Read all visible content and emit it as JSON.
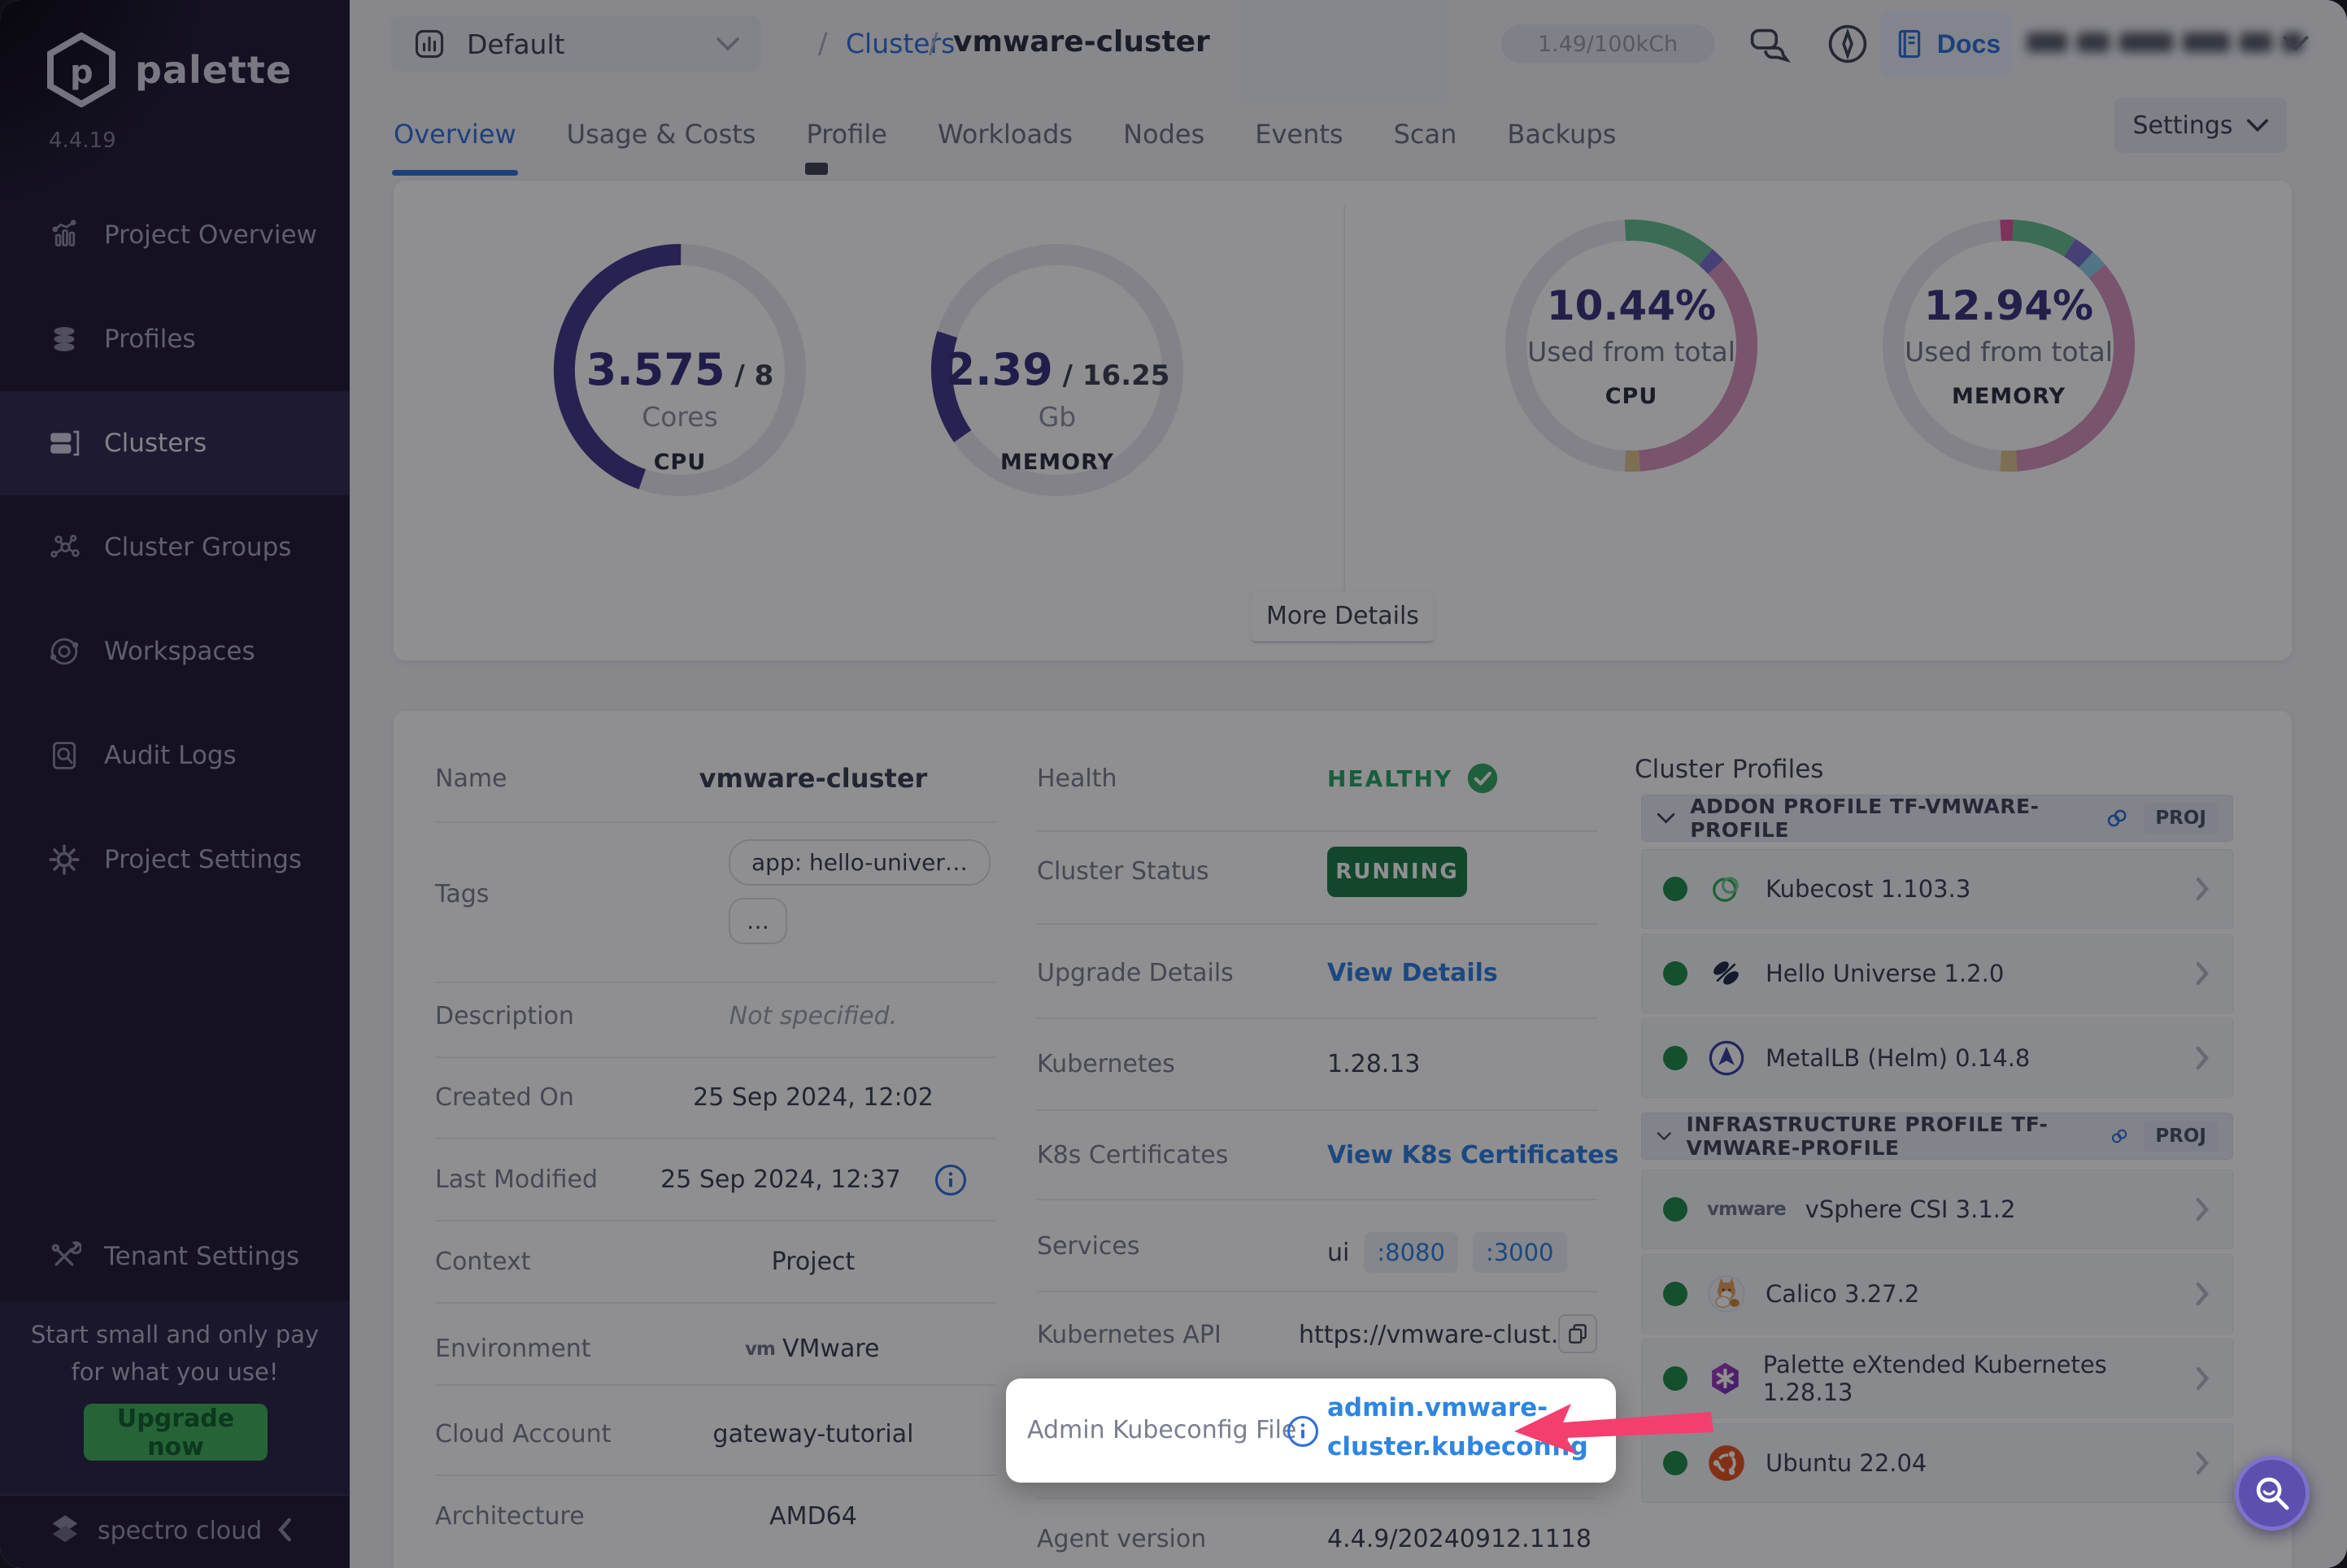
{
  "colors": {
    "accent_blue": "#2f6fd9",
    "link_blue": "#2f7fe0",
    "healthy_green": "#27a567",
    "running_green": "#1d7c45",
    "donut_purple": "#443a8c",
    "arrow_pink": "#f43f6e",
    "sidebar_bg": "#221b38",
    "upgrade_green": "#41b15b"
  },
  "icons": {
    "search": "magnifier",
    "docs": "book",
    "chat": "speech-bubbles",
    "explore": "compass",
    "copy": "copy-sheets",
    "info": "info-circle",
    "healthy_check": "check-circle",
    "profile_link": "chain-link",
    "chevron_down": "chevron-down",
    "chevron_right": "chevron-right"
  },
  "sidebar": {
    "brand": "palette",
    "version": "4.4.19",
    "items": [
      {
        "label": "Project Overview"
      },
      {
        "label": "Profiles"
      },
      {
        "label": "Clusters"
      },
      {
        "label": "Cluster Groups"
      },
      {
        "label": "Workspaces"
      },
      {
        "label": "Audit Logs"
      },
      {
        "label": "Project Settings"
      }
    ],
    "active_item": "Clusters",
    "tenant_settings": "Tenant Settings",
    "promo_line1": "Start small and only pay",
    "promo_line2": "for what you use!",
    "upgrade_button": "Upgrade now",
    "footer_brand": "spectro cloud"
  },
  "topbar": {
    "project_selector": "Default",
    "breadcrumb_sep1": "/",
    "breadcrumb_link": "Clusters",
    "breadcrumb_sep2": "/",
    "breadcrumb_current": "vmware-cluster",
    "credits": "1.49/100kCh",
    "docs_label": "Docs"
  },
  "tabs": {
    "items": [
      {
        "label": "Overview"
      },
      {
        "label": "Usage & Costs"
      },
      {
        "label": "Profile"
      },
      {
        "label": "Workloads"
      },
      {
        "label": "Nodes"
      },
      {
        "label": "Events"
      },
      {
        "label": "Scan"
      },
      {
        "label": "Backups"
      }
    ],
    "active": "Overview",
    "settings_button": "Settings"
  },
  "charts": {
    "more_details_button": "More Details"
  },
  "chart_data": {
    "type": "donut-group",
    "track_color": "#e7e8ef",
    "donuts": [
      {
        "name": "cpu-cores",
        "value": "3.575",
        "total_suffix": " / 8",
        "unit": "Cores",
        "label": "CPU",
        "used": 3.575,
        "total": 8,
        "segments": [
          {
            "from": 199,
            "to": 360.5,
            "color": "#443a8c"
          }
        ]
      },
      {
        "name": "memory-gb",
        "value": "2.39",
        "total_suffix": " / 16.25",
        "unit": "Gb",
        "label": "MEMORY",
        "used": 2.39,
        "total": 16.25,
        "segments": [
          {
            "from": 235,
            "to": 288,
            "color": "#443a8c"
          }
        ]
      },
      {
        "name": "cpu-percent",
        "value": "10.44%",
        "subtitle": "Used from total",
        "label": "CPU",
        "percent": 10.44,
        "segments": [
          {
            "from": -3,
            "to": 40,
            "color": "#69bf92"
          },
          {
            "from": 40,
            "to": 47,
            "color": "#7a6fd0"
          },
          {
            "from": 47,
            "to": 176,
            "color": "#d694bd"
          },
          {
            "from": 176,
            "to": 183,
            "color": "#dfc58e"
          }
        ]
      },
      {
        "name": "memory-percent",
        "value": "12.94%",
        "subtitle": "Used from total",
        "label": "MEMORY",
        "percent": 12.94,
        "segments": [
          {
            "from": -4,
            "to": 2,
            "color": "#e2569b"
          },
          {
            "from": 2,
            "to": 32,
            "color": "#69bf92"
          },
          {
            "from": 32,
            "to": 42,
            "color": "#7a6fd0"
          },
          {
            "from": 42,
            "to": 50,
            "color": "#8fd0e8"
          },
          {
            "from": 50,
            "to": 176,
            "color": "#d694bd"
          },
          {
            "from": 176,
            "to": 184,
            "color": "#dfc58e"
          }
        ]
      }
    ]
  },
  "details": {
    "left": {
      "name_label": "Name",
      "name_value": "vmware-cluster",
      "tags_label": "Tags",
      "tag_chips": [
        "app: hello-univer…",
        "…"
      ],
      "description_label": "Description",
      "description_value": "Not specified.",
      "created_label": "Created On",
      "created_value": "25 Sep 2024, 12:02",
      "modified_label": "Last Modified",
      "modified_value": "25 Sep 2024, 12:37",
      "context_label": "Context",
      "context_value": "Project",
      "environment_label": "Environment",
      "environment_logo": "vm",
      "environment_value": "VMware",
      "cloud_label": "Cloud Account",
      "cloud_value": "gateway-tutorial",
      "arch_label": "Architecture",
      "arch_value": "AMD64"
    },
    "middle": {
      "health_label": "Health",
      "health_value": "HEALTHY",
      "status_label": "Cluster Status",
      "status_value": "RUNNING",
      "upgrade_label": "Upgrade Details",
      "upgrade_value": "View Details",
      "k8s_label": "Kubernetes",
      "k8s_value": "1.28.13",
      "cert_label": "K8s Certificates",
      "cert_value": "View K8s Certificates",
      "services_label": "Services",
      "services_name": "ui",
      "services_ports": [
        ":8080",
        ":3000"
      ],
      "api_label": "Kubernetes API",
      "api_value": "https://vmware-clust…",
      "kubeconfig_label": "Admin Kubeconfig File",
      "kubeconfig_line1": "admin.vmware-",
      "kubeconfig_line2": "cluster.kubeconfig",
      "agent_label": "Agent version",
      "agent_value": "4.4.9/20240912.1118"
    },
    "profiles": {
      "title": "Cluster Profiles",
      "sections": [
        {
          "header": "ADDON PROFILE TF-VMWARE-PROFILE",
          "badge": "PROJ",
          "items": [
            {
              "name": "Kubecost 1.103.3"
            },
            {
              "name": "Hello Universe 1.2.0"
            },
            {
              "name": "MetalLB (Helm) 0.14.8"
            }
          ]
        },
        {
          "header": "INFRASTRUCTURE PROFILE TF-VMWARE-PROFILE",
          "badge": "PROJ",
          "items": [
            {
              "name": "vSphere CSI 3.1.2"
            },
            {
              "name": "Calico 3.27.2"
            },
            {
              "name": "Palette eXtended Kubernetes 1.28.13"
            },
            {
              "name": "Ubuntu 22.04"
            }
          ]
        }
      ]
    }
  }
}
